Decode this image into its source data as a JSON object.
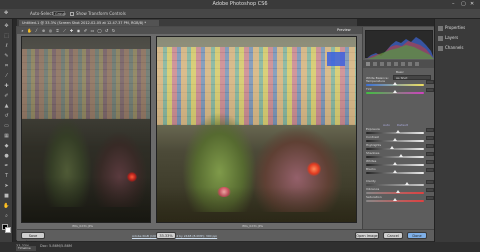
{
  "app": {
    "title": "Adobe Photoshop CS6",
    "window_controls": [
      "–",
      "▢",
      "✕"
    ]
  },
  "options_bar": {
    "auto_select_label": "Auto-Select:",
    "auto_select_value": "Group",
    "show_transform_label": "Show Transform Controls"
  },
  "document_tab": {
    "label": "Untitled-1 @ 33.3% (Screen Shot 2012-02-05 at 12.47.37 PM, RGB/8) *"
  },
  "camera_raw": {
    "preview_label": "Preview",
    "before_caption": "IMG_0231.JPG",
    "after_caption": "IMG_0231.JPG",
    "footer_link": "Adobe RGB (1998); 8 bit; 3264 by 2448 (8.0MP); 300 ppi",
    "buttons": {
      "save": "Save Image...",
      "open": "Open Image",
      "cancel": "Cancel",
      "done": "Done"
    },
    "panel": {
      "section_title": "Basic",
      "white_balance_label": "White Balance:",
      "white_balance_value": "As Shot",
      "auto_label": "Auto",
      "default_label": "Default",
      "sliders": [
        {
          "label": "Temperature",
          "value": 0.5
        },
        {
          "label": "Tint",
          "value": 0.5
        },
        {
          "label": "Exposure",
          "value": 0.55
        },
        {
          "label": "Contrast",
          "value": 0.5
        },
        {
          "label": "Highlights",
          "value": 0.45
        },
        {
          "label": "Shadows",
          "value": 0.6
        },
        {
          "label": "Whites",
          "value": 0.5
        },
        {
          "label": "Blacks",
          "value": 0.5
        },
        {
          "label": "Clarity",
          "value": 0.7
        },
        {
          "label": "Vibrance",
          "value": 0.55
        },
        {
          "label": "Saturation",
          "value": 0.5
        }
      ]
    }
  },
  "right_dock": {
    "items": [
      "Properties",
      "Layers",
      "Channels"
    ]
  },
  "status": {
    "zoom": "33.33%",
    "doc": "Doc: 5.86M/5.86M",
    "timeline": "Timeline"
  },
  "colors": {
    "background": "#282828",
    "dialog": "#6b6b6b",
    "accent": "#7fb0e8"
  }
}
